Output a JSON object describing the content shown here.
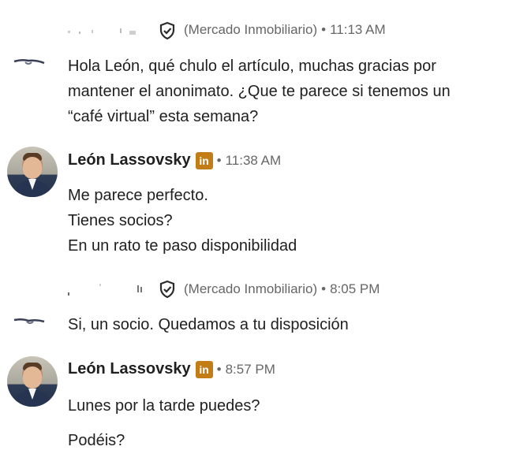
{
  "messages": [
    {
      "sender_type": "anonymous",
      "company": "(Mercado Inmobiliario)",
      "time": "11:13 AM",
      "lines": [
        "Hola León, qué chulo el artículo, muchas gracias por",
        "mantener el anonimato. ¿Que te parece si tenemos un",
        "“café virtual” esta semana?"
      ]
    },
    {
      "sender_type": "named",
      "name": "León Lassovsky",
      "badge": "in",
      "time": "11:38 AM",
      "lines": [
        "Me parece perfecto.",
        "Tienes socios?",
        "En un rato te paso disponibilidad"
      ]
    },
    {
      "sender_type": "anonymous",
      "company": "(Mercado Inmobiliario)",
      "time": "8:05 PM",
      "lines": [
        "Si, un socio. Quedamos a tu disposición"
      ]
    },
    {
      "sender_type": "named",
      "name": "León Lassovsky",
      "badge": "in",
      "time": "8:57 PM",
      "lines": [
        "Lunes por la tarde puedes?"
      ],
      "extra_lines": [
        "Podéis?"
      ]
    }
  ],
  "separator": "•",
  "icons": {
    "verified": "shield-check-icon",
    "linkedin": "linkedin-badge-icon"
  },
  "colors": {
    "badge": "#c37d16",
    "meta_text": "#666666",
    "body_text": "#1f1f1f"
  }
}
